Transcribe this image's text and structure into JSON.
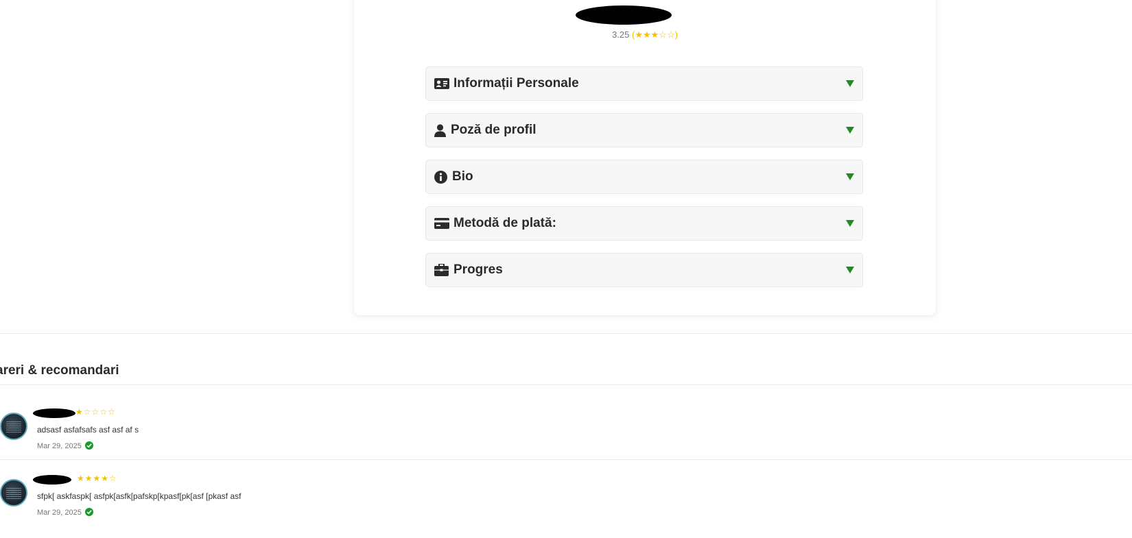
{
  "profile": {
    "rating_value": "3.25",
    "rating_stars": "(★★★☆☆)"
  },
  "sections": [
    {
      "title": "Informații Personale",
      "icon": "id-card-icon"
    },
    {
      "title": "Poză de profil",
      "icon": "user-icon"
    },
    {
      "title": "Bio",
      "icon": "info-circle-icon"
    },
    {
      "title": "Metodă de plată:",
      "icon": "credit-card-icon"
    },
    {
      "title": "Progres",
      "icon": "briefcase-icon"
    }
  ],
  "reviews": {
    "heading": "areri & recomandari",
    "items": [
      {
        "stars": "★☆☆☆☆",
        "text": "adsasf asfafsafs asf asf af s",
        "date": "Mar 29, 2025"
      },
      {
        "stars": "★★★★☆",
        "text": "sfpk[ askfaspk[ asfpk[asfk[pafskp[kpasf[pk[asf [pkasf asf",
        "date": "Mar 29, 2025"
      }
    ]
  },
  "colors": {
    "accent_green": "#1f8a1f",
    "star_yellow": "#f2c200"
  }
}
